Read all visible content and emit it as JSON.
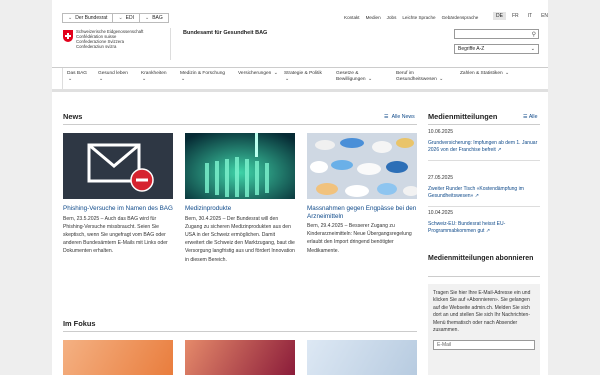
{
  "breadcrumb": {
    "items": [
      "Der Bundesrat",
      "EDI",
      "BAG"
    ]
  },
  "top_links": [
    "Kontakt",
    "Medien",
    "Jobs",
    "Leichte Sprache",
    "Gebärdensprache"
  ],
  "languages": [
    "DE",
    "FR",
    "IT",
    "EN"
  ],
  "active_language": "DE",
  "header": {
    "confederation": [
      "Schweizerische Eidgenossenschaft",
      "Confédération suisse",
      "Confederazione Svizzera",
      "Confederaziun svizra"
    ],
    "office": "Bundesamt für Gesundheit BAG",
    "search_placeholder": "",
    "select_value": "Begriffe A-Z"
  },
  "nav": [
    {
      "label": "Das BAG"
    },
    {
      "label": "Gesund leben"
    },
    {
      "label": "Krankheiten"
    },
    {
      "label": "Medizin & Forschung"
    },
    {
      "label": "Versicherungen"
    },
    {
      "label": "Strategie & Politik"
    },
    {
      "label": "Gesetze & Bewilligungen"
    },
    {
      "label": "Beruf im Gesundheitswesen"
    },
    {
      "label": "Zahlen & Statistiken"
    }
  ],
  "news": {
    "title": "News",
    "all_label": "Alle News",
    "cards": [
      {
        "title": "Phishing-Versuche im Namen des BAG",
        "text": "Bern, 23.5.2025 – Auch das BAG wird für Phishing-Versuche missbraucht. Seien Sie skeptisch, wenn Sie ungefragt vom BAG oder anderen Bundesämtern E-Mails mit Links oder Dokumenten erhalten."
      },
      {
        "title": "Medizinprodukte",
        "text": "Bern, 30.4.2025 – Der Bundesrat will den Zugang zu sicheren Medizinprodukten aus den USA in der Schweiz ermöglichen. Damit erweitert die Schweiz den Marktzugang, baut die Versorgung langfristig aus und fördert Innovation in diesem Bereich."
      },
      {
        "title": "Massnahmen gegen Engpässe bei den Arzneimitteln",
        "text": "Bern, 29.4.2025 – Besserer Zugang zu Kinderarzneimitteln: Neue Übergangsregelung erlaubt den Import dringend benötigter Medikamente."
      }
    ]
  },
  "focus": {
    "title": "Im Fokus"
  },
  "press": {
    "title": "Medienmitteilungen",
    "all_label": "Alle",
    "items": [
      {
        "date": "10.06.2025",
        "text": "Grundversicherung: Impfungen ab dem 1. Januar 2026 von der Franchise befreit"
      },
      {
        "date": "27.05.2025",
        "text": "Zweiter Runder Tisch «Kostendämpfung im Gesundheitswesen»"
      },
      {
        "date": "10.04.2025",
        "text": "Schweiz-EU: Bundesrat heisst EU-Programmabkommen gut"
      }
    ]
  },
  "subscribe": {
    "title": "Medienmitteilungen abonnieren",
    "text": "Tragen Sie hier Ihre E-Mail-Adresse ein und klicken Sie auf «Abonnieren». Sie gelangen auf die Webseite admin.ch. Melden Sie sich dort an und stellen Sie sich Ihr Nachrichten-Menü thematisch oder nach Absender zusammen.",
    "email_placeholder": "E-Mail"
  },
  "colors": {
    "accent": "#e3001b",
    "link": "#0f4a8a",
    "background": "#eeeeee"
  },
  "icons": {
    "external": "external-link-icon",
    "list": "list-icon",
    "search": "search-icon"
  }
}
